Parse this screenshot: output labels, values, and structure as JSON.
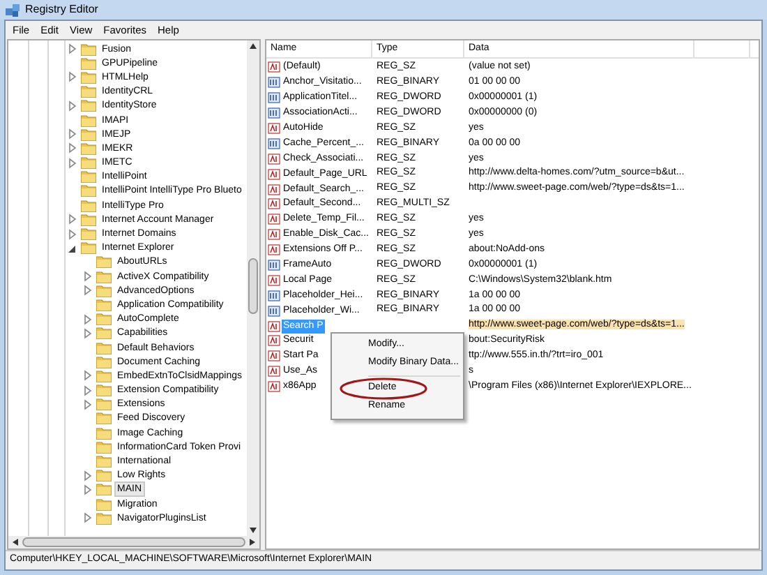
{
  "window": {
    "title": "Registry Editor"
  },
  "menu": [
    "File",
    "Edit",
    "View",
    "Favorites",
    "Help"
  ],
  "tree": [
    {
      "label": "Fusion",
      "has_children": true,
      "expanded": false,
      "selected": false
    },
    {
      "label": "GPUPipeline",
      "has_children": false,
      "expanded": false,
      "selected": false
    },
    {
      "label": "HTMLHelp",
      "has_children": true,
      "expanded": false,
      "selected": false
    },
    {
      "label": "IdentityCRL",
      "has_children": false,
      "expanded": false,
      "selected": false
    },
    {
      "label": "IdentityStore",
      "has_children": true,
      "expanded": false,
      "selected": false
    },
    {
      "label": "IMAPI",
      "has_children": false,
      "expanded": false,
      "selected": false
    },
    {
      "label": "IMEJP",
      "has_children": true,
      "expanded": false,
      "selected": false
    },
    {
      "label": "IMEKR",
      "has_children": true,
      "expanded": false,
      "selected": false
    },
    {
      "label": "IMETC",
      "has_children": true,
      "expanded": false,
      "selected": false
    },
    {
      "label": "IntelliPoint",
      "has_children": false,
      "expanded": false,
      "selected": false
    },
    {
      "label": "IntelliPoint IntelliType Pro Blueto",
      "has_children": false,
      "expanded": false,
      "selected": false
    },
    {
      "label": "IntelliType Pro",
      "has_children": false,
      "expanded": false,
      "selected": false
    },
    {
      "label": "Internet Account Manager",
      "has_children": true,
      "expanded": false,
      "selected": false
    },
    {
      "label": "Internet Domains",
      "has_children": true,
      "expanded": false,
      "selected": false
    },
    {
      "label": "Internet Explorer",
      "has_children": true,
      "expanded": true,
      "selected": false,
      "children": [
        {
          "label": "AboutURLs",
          "has_children": false,
          "expanded": false,
          "selected": false
        },
        {
          "label": "ActiveX Compatibility",
          "has_children": true,
          "expanded": false,
          "selected": false
        },
        {
          "label": "AdvancedOptions",
          "has_children": true,
          "expanded": false,
          "selected": false
        },
        {
          "label": "Application Compatibility",
          "has_children": false,
          "expanded": false,
          "selected": false
        },
        {
          "label": "AutoComplete",
          "has_children": true,
          "expanded": false,
          "selected": false
        },
        {
          "label": "Capabilities",
          "has_children": true,
          "expanded": false,
          "selected": false
        },
        {
          "label": "Default Behaviors",
          "has_children": false,
          "expanded": false,
          "selected": false
        },
        {
          "label": "Document Caching",
          "has_children": false,
          "expanded": false,
          "selected": false
        },
        {
          "label": "EmbedExtnToClsidMappings",
          "has_children": true,
          "expanded": false,
          "selected": false
        },
        {
          "label": "Extension Compatibility",
          "has_children": true,
          "expanded": false,
          "selected": false
        },
        {
          "label": "Extensions",
          "has_children": true,
          "expanded": false,
          "selected": false
        },
        {
          "label": "Feed Discovery",
          "has_children": false,
          "expanded": false,
          "selected": false
        },
        {
          "label": "Image Caching",
          "has_children": false,
          "expanded": false,
          "selected": false
        },
        {
          "label": "InformationCard Token Provi",
          "has_children": false,
          "expanded": false,
          "selected": false
        },
        {
          "label": "International",
          "has_children": false,
          "expanded": false,
          "selected": false
        },
        {
          "label": "Low Rights",
          "has_children": true,
          "expanded": false,
          "selected": false
        },
        {
          "label": "MAIN",
          "has_children": true,
          "expanded": false,
          "selected": true
        },
        {
          "label": "Migration",
          "has_children": false,
          "expanded": false,
          "selected": false
        },
        {
          "label": "NavigatorPluginsList",
          "has_children": true,
          "expanded": false,
          "selected": false
        }
      ]
    }
  ],
  "table": {
    "columns": [
      "Name",
      "Type",
      "Data"
    ],
    "rows": [
      {
        "kind": "string",
        "name": "(Default)",
        "type": "REG_SZ",
        "data": "(value not set)",
        "selected": false
      },
      {
        "kind": "binary",
        "name": "Anchor_Visitatio...",
        "type": "REG_BINARY",
        "data": "01 00 00 00",
        "selected": false
      },
      {
        "kind": "binary",
        "name": "ApplicationTitel...",
        "type": "REG_DWORD",
        "data": "0x00000001 (1)",
        "selected": false
      },
      {
        "kind": "binary",
        "name": "AssociationActi...",
        "type": "REG_DWORD",
        "data": "0x00000000 (0)",
        "selected": false
      },
      {
        "kind": "string",
        "name": "AutoHide",
        "type": "REG_SZ",
        "data": "yes",
        "selected": false
      },
      {
        "kind": "binary",
        "name": "Cache_Percent_...",
        "type": "REG_BINARY",
        "data": "0a 00 00 00",
        "selected": false
      },
      {
        "kind": "string",
        "name": "Check_Associati...",
        "type": "REG_SZ",
        "data": "yes",
        "selected": false
      },
      {
        "kind": "string",
        "name": "Default_Page_URL",
        "type": "REG_SZ",
        "data": "http://www.delta-homes.com/?utm_source=b&ut...",
        "selected": false
      },
      {
        "kind": "string",
        "name": "Default_Search_...",
        "type": "REG_SZ",
        "data": "http://www.sweet-page.com/web/?type=ds&ts=1...",
        "selected": false
      },
      {
        "kind": "string",
        "name": "Default_Second...",
        "type": "REG_MULTI_SZ",
        "selected": false
      },
      {
        "kind": "string",
        "name": "Delete_Temp_Fil...",
        "type": "REG_SZ",
        "data": "yes",
        "selected": false
      },
      {
        "kind": "string",
        "name": "Enable_Disk_Cac...",
        "type": "REG_SZ",
        "data": "yes",
        "selected": false
      },
      {
        "kind": "string",
        "name": "Extensions Off P...",
        "type": "REG_SZ",
        "data": "about:NoAdd-ons",
        "selected": false
      },
      {
        "kind": "binary",
        "name": "FrameAuto",
        "type": "REG_DWORD",
        "data": "0x00000001 (1)",
        "selected": false
      },
      {
        "kind": "string",
        "name": "Local Page",
        "type": "REG_SZ",
        "data": "C:\\Windows\\System32\\blank.htm",
        "selected": false
      },
      {
        "kind": "binary",
        "name": "Placeholder_Hei...",
        "type": "REG_BINARY",
        "data": "1a 00 00 00",
        "selected": false
      },
      {
        "kind": "binary",
        "name": "Placeholder_Wi...",
        "type": "REG_BINARY",
        "data": "1a 00 00 00",
        "selected": false
      },
      {
        "kind": "string",
        "name": "Search P",
        "data": "http://www.sweet-page.com/web/?type=ds&ts=1...",
        "selected": true
      },
      {
        "kind": "string",
        "name": "Securit",
        "data": "bout:SecurityRisk",
        "selected": false
      },
      {
        "kind": "string",
        "name": "Start Pa",
        "data": "ttp://www.555.in.th/?trt=iro_001",
        "selected": false
      },
      {
        "kind": "string",
        "name": "Use_As",
        "data": "s",
        "selected": false
      },
      {
        "kind": "string",
        "name": "x86App",
        "data": "\\Program Files (x86)\\Internet Explorer\\IEXPLORE...",
        "selected": false
      }
    ]
  },
  "context_menu": [
    {
      "label": "Modify...",
      "kind": "item",
      "circled": false
    },
    {
      "label": "Modify Binary Data...",
      "kind": "item",
      "circled": false
    },
    {
      "kind": "separator"
    },
    {
      "label": "Delete",
      "kind": "item",
      "circled": true
    },
    {
      "label": "Rename",
      "kind": "item",
      "circled": false
    }
  ],
  "status_bar": "Computer\\HKEY_LOCAL_MACHINE\\SOFTWARE\\Microsoft\\Internet Explorer\\MAIN"
}
